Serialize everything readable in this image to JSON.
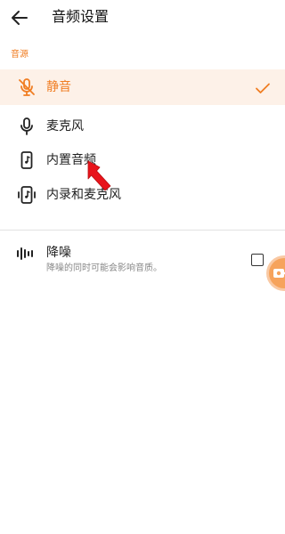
{
  "header": {
    "title": "音频设置"
  },
  "section": {
    "label": "音源"
  },
  "sources": {
    "items": [
      {
        "label": "静音",
        "icon": "mic-off-icon",
        "selected": true
      },
      {
        "label": "麦克风",
        "icon": "mic-icon",
        "selected": false
      },
      {
        "label": "内置音频",
        "icon": "phone-music-icon",
        "selected": false
      },
      {
        "label": "内录和麦克风",
        "icon": "phone-mic-icon",
        "selected": false
      }
    ]
  },
  "noise_reduction": {
    "title": "降噪",
    "description": "降噪的同时可能会影响音质。",
    "checked": false
  },
  "colors": {
    "accent": "#f07d22",
    "selected_bg": "#fdf1e8",
    "pointer": "#e8141b",
    "float_button": "#f6a35c"
  }
}
